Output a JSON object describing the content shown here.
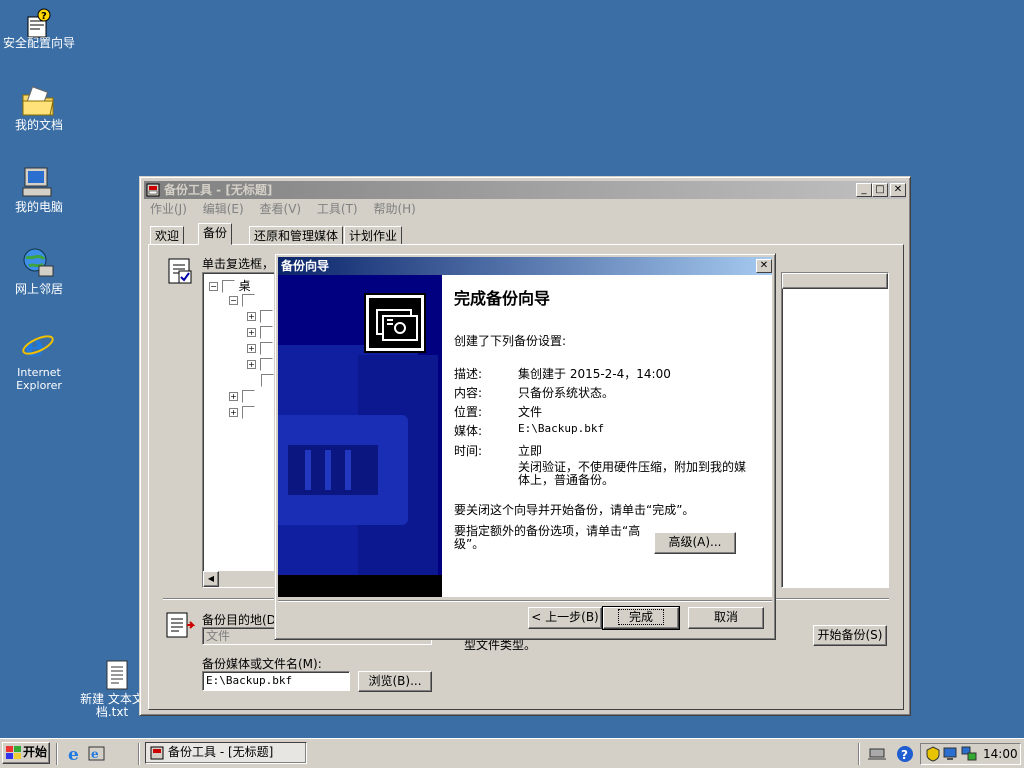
{
  "desktop": {
    "icons": [
      {
        "label": "安全配置向导"
      },
      {
        "label": "我的文档"
      },
      {
        "label": "我的电脑"
      },
      {
        "label": "网上邻居"
      },
      {
        "label": "Internet Explorer"
      },
      {
        "label": "新建 文本文档.txt"
      }
    ]
  },
  "main_window": {
    "title": "备份工具 - [无标题]",
    "menu": [
      "作业(J)",
      "编辑(E)",
      "查看(V)",
      "工具(T)",
      "帮助(H)"
    ],
    "tabs": [
      "欢迎",
      "备份",
      "还原和管理媒体",
      "计划作业"
    ],
    "active_tab": "备份",
    "tree_hint": "单击复选框，选",
    "tree_root": "桌",
    "backup_dest_label": "备份目的地(D):",
    "backup_dest_value": "文件",
    "media_label": "备份媒体或文件名(M):",
    "media_value": "E:\\Backup.bkf",
    "browse_button": "浏览(B)...",
    "start_button": "开始备份(S)",
    "partial_text": "型文件类型。"
  },
  "wizard": {
    "title": "备份向导",
    "heading": "完成备份向导",
    "intro": "创建了下列备份设置:",
    "settings": [
      {
        "key": "描述:",
        "value": "集创建于 2015-2-4，14:00"
      },
      {
        "key": "内容:",
        "value": "只备份系统状态。"
      },
      {
        "key": "位置:",
        "value": "文件"
      },
      {
        "key": "媒体:",
        "value": "E:\\Backup.bkf"
      },
      {
        "key": "时间:",
        "value": "立即"
      }
    ],
    "note": "关闭验证，不使用硬件压缩，附加到我的媒体上，普通备份。",
    "finish_text": "要关闭这个向导并开始备份，请单击“完成”。",
    "advanced_text": "要指定额外的备份选项，请单击“高级”。",
    "advanced_button": "高级(A)...",
    "back_button": "< 上一步(B)",
    "finish_button": "完成",
    "cancel_button": "取消"
  },
  "taskbar": {
    "start_label": "开始",
    "task_label": "备份工具 - [无标题]",
    "clock": "14:00"
  },
  "colors": {
    "desktop": "#3a6ea5",
    "active_title": "#0a246a",
    "inactive_title": "#808080",
    "sidebar": "#000080"
  }
}
